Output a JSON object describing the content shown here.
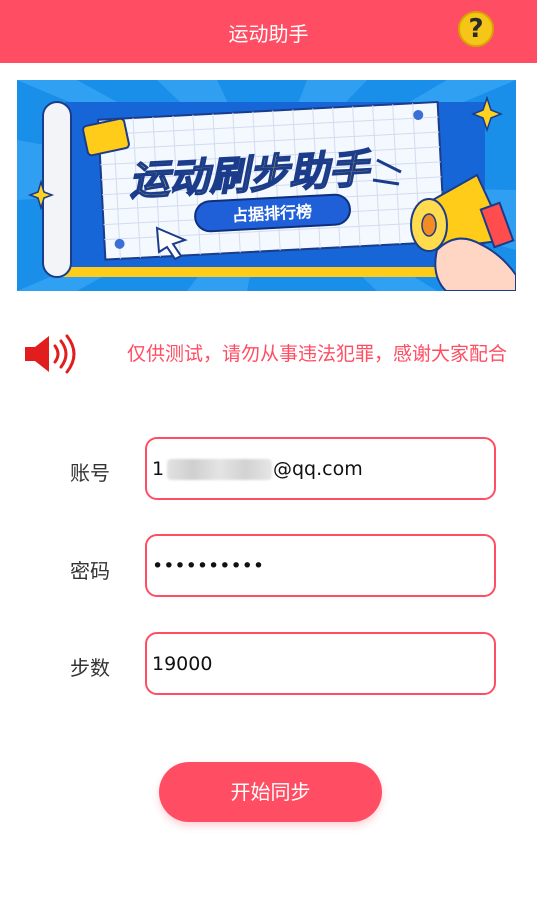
{
  "header": {
    "title": "运动助手",
    "help_icon": "question-icon"
  },
  "banner": {
    "headline": "运动刷步助手",
    "badge": "占据排行榜"
  },
  "notice": {
    "icon": "speaker-icon",
    "text": "仅供测试，请勿从事违法犯罪，感谢大家配合"
  },
  "form": {
    "account": {
      "label": "账号",
      "prefix": "1",
      "suffix": "@qq.com"
    },
    "password": {
      "label": "密码",
      "value": "••••••••••"
    },
    "steps": {
      "label": "步数",
      "value": "19000"
    }
  },
  "actions": {
    "start_label": "开始同步"
  },
  "colors": {
    "accent": "#ff4d63",
    "banner_blue": "#1e94f0",
    "yellow": "#f5c518"
  }
}
